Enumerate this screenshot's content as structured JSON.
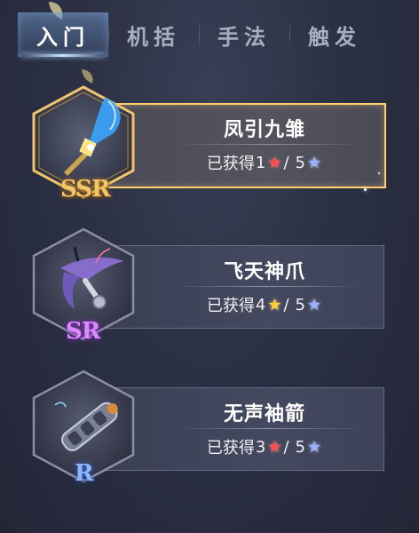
{
  "tabs": [
    {
      "label": "入门",
      "active": true
    },
    {
      "label": "机括",
      "active": false
    },
    {
      "label": "手法",
      "active": false
    },
    {
      "label": "触发",
      "active": false
    }
  ],
  "cards": [
    {
      "name": "凤引九雏",
      "rarity": "SSR",
      "progress_prefix": "已获得",
      "owned": "1",
      "owned_star_color": "red",
      "separator": "/",
      "total": "5",
      "total_star_color": "blue",
      "icon": "blue-feather-dart-icon",
      "selected": true
    },
    {
      "name": "飞天神爪",
      "rarity": "SR",
      "progress_prefix": "已获得",
      "owned": "4",
      "owned_star_color": "yellow",
      "separator": "/",
      "total": "5",
      "total_star_color": "blue",
      "icon": "grappling-claw-icon",
      "selected": false
    },
    {
      "name": "无声袖箭",
      "rarity": "R",
      "progress_prefix": "已获得",
      "owned": "3",
      "owned_star_color": "red",
      "separator": "/",
      "total": "5",
      "total_star_color": "blue",
      "icon": "sleeve-crossbow-icon",
      "selected": false
    }
  ],
  "colors": {
    "selected_border": "#ffcf6e",
    "ssr": "#f3c66a",
    "sr": "#d98bff",
    "r": "#8fb6ff"
  }
}
